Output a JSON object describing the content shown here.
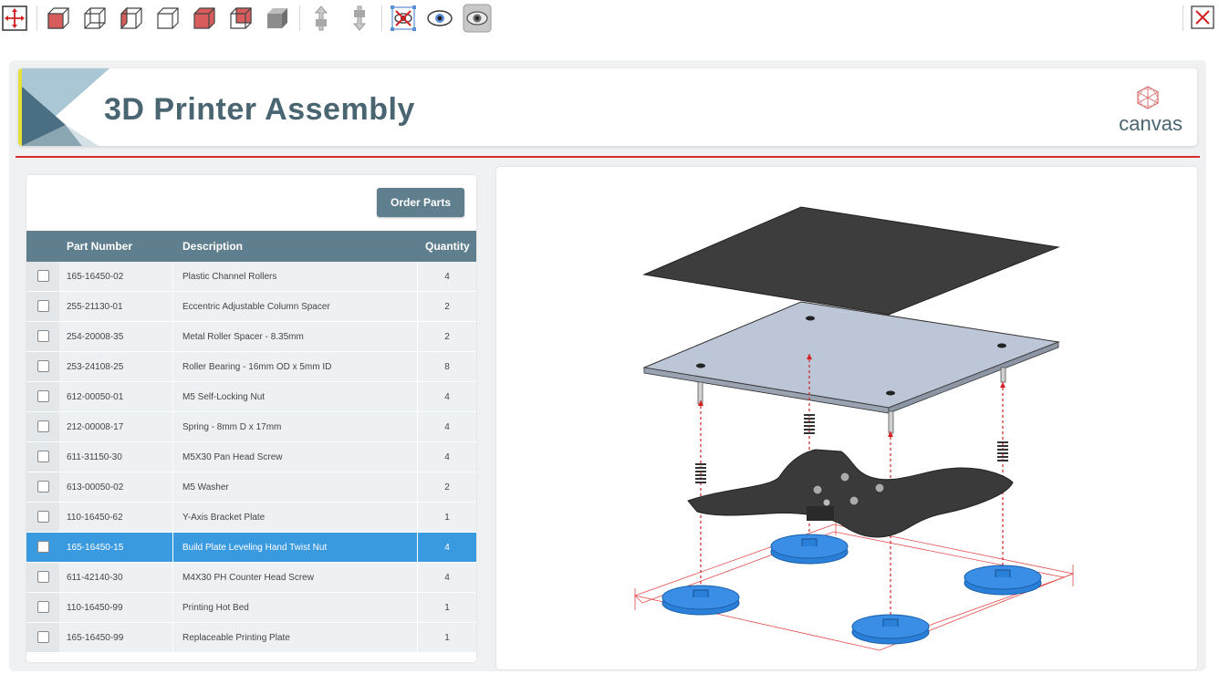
{
  "toolbar": {
    "tools": [
      {
        "icon": "fit-view-icon"
      },
      {
        "icon": "cube-view-front-icon"
      },
      {
        "icon": "cube-view-bottom-icon"
      },
      {
        "icon": "cube-view-left-icon"
      },
      {
        "icon": "cube-view-right-icon"
      },
      {
        "icon": "cube-view-top-icon"
      },
      {
        "icon": "cube-view-back-icon"
      },
      {
        "icon": "cube-shaded-icon"
      },
      {
        "icon": "explode-up-icon"
      },
      {
        "icon": "explode-down-icon"
      },
      {
        "icon": "hide-selection-icon"
      },
      {
        "icon": "show-icon"
      },
      {
        "icon": "show-all-icon"
      }
    ],
    "close_icon": "close-icon"
  },
  "header": {
    "title": "3D Printer Assembly",
    "logo_text": "canvas"
  },
  "parts_panel": {
    "order_button": "Order Parts",
    "columns": {
      "part_number": "Part Number",
      "description": "Description",
      "quantity": "Quantity"
    },
    "rows": [
      {
        "part_number": "165-16450-02",
        "description": "Plastic Channel Rollers",
        "quantity": "4",
        "selected": false
      },
      {
        "part_number": "255-21130-01",
        "description": "Eccentric Adjustable Column Spacer",
        "quantity": "2",
        "selected": false
      },
      {
        "part_number": "254-20008-35",
        "description": "Metal Roller Spacer - 8.35mm",
        "quantity": "2",
        "selected": false
      },
      {
        "part_number": "253-24108-25",
        "description": "Roller Bearing - 16mm OD x 5mm ID",
        "quantity": "8",
        "selected": false
      },
      {
        "part_number": "612-00050-01",
        "description": "M5 Self-Locking Nut",
        "quantity": "4",
        "selected": false
      },
      {
        "part_number": "212-00008-17",
        "description": "Spring - 8mm D x 17mm",
        "quantity": "4",
        "selected": false
      },
      {
        "part_number": "611-31150-30",
        "description": "M5X30 Pan Head Screw",
        "quantity": "4",
        "selected": false
      },
      {
        "part_number": "613-00050-02",
        "description": "M5 Washer",
        "quantity": "2",
        "selected": false
      },
      {
        "part_number": "110-16450-62",
        "description": "Y-Axis Bracket Plate",
        "quantity": "1",
        "selected": false
      },
      {
        "part_number": "165-16450-15",
        "description": "Build Plate Leveling Hand Twist Nut",
        "quantity": "4",
        "selected": true
      },
      {
        "part_number": "611-42140-30",
        "description": "M4X30 PH Counter Head Screw",
        "quantity": "4",
        "selected": false
      },
      {
        "part_number": "110-16450-99",
        "description": "Printing Hot Bed",
        "quantity": "1",
        "selected": false
      },
      {
        "part_number": "165-16450-99",
        "description": "Replaceable Printing Plate",
        "quantity": "1",
        "selected": false
      }
    ]
  },
  "viewer": {
    "highlight_color": "#3a8ee6",
    "explode_line_color": "#d42020"
  },
  "colors": {
    "accent": "#5f7f8e",
    "selected_row": "#3a9ae0",
    "rule": "#d92e2e",
    "title": "#4a6572"
  }
}
